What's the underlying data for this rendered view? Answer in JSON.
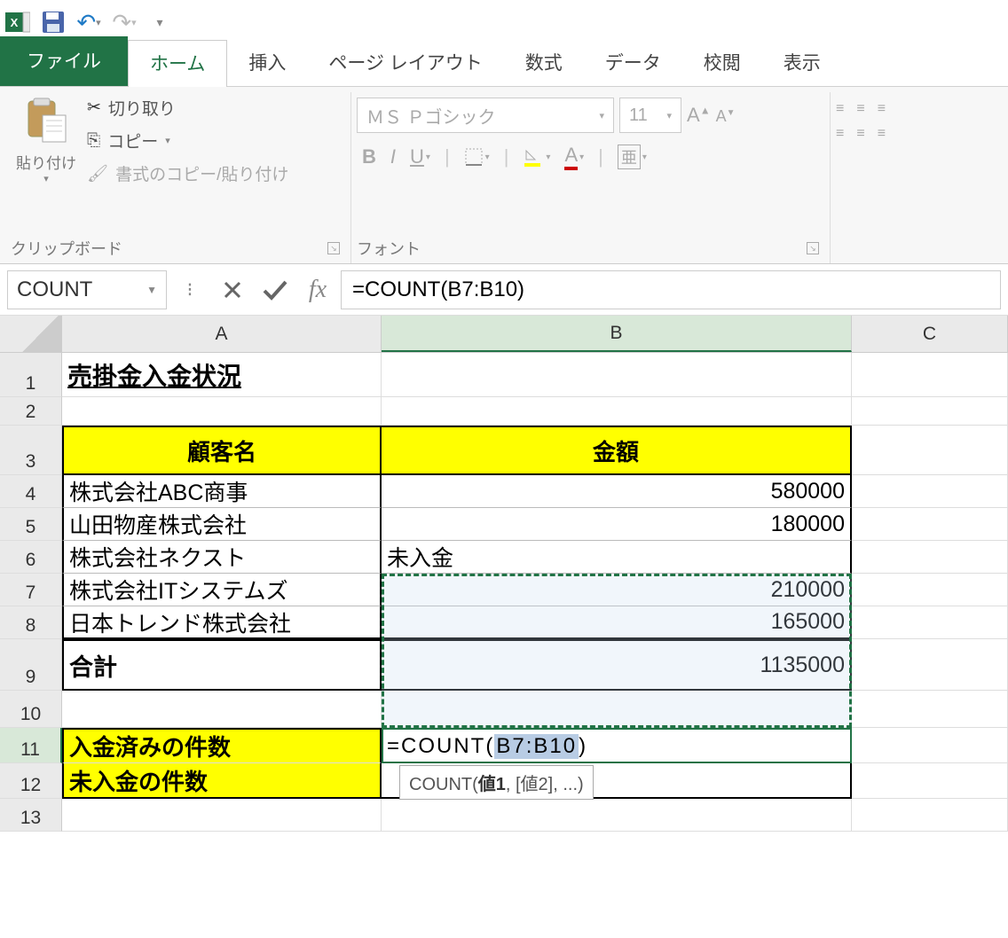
{
  "qat": {
    "save": "保存"
  },
  "ribbon": {
    "tabs": {
      "file": "ファイル",
      "home": "ホーム",
      "insert": "挿入",
      "layout": "ページ レイアウト",
      "formulas": "数式",
      "data": "データ",
      "review": "校閲",
      "view": "表示"
    },
    "clipboard": {
      "paste": "貼り付け",
      "cut": "切り取り",
      "copy": "コピー",
      "format_painter": "書式のコピー/貼り付け",
      "label": "クリップボード"
    },
    "font": {
      "font_name": "ＭＳ Ｐゴシック",
      "font_size": "11",
      "label": "フォント",
      "ruby": "亜"
    }
  },
  "formula_bar": {
    "name_box": "COUNT",
    "formula": "=COUNT(B7:B10)"
  },
  "cols": {
    "A": "A",
    "B": "B",
    "C": "C"
  },
  "sheet": {
    "title": "売掛金入金状況",
    "header_a": "顧客名",
    "header_b": "金額",
    "rows": [
      {
        "name": "株式会社ABC商事",
        "value": "580000"
      },
      {
        "name": "山田物産株式会社",
        "value": "180000"
      },
      {
        "name": "株式会社ネクスト",
        "value": "未入金"
      },
      {
        "name": "株式会社ITシステムズ",
        "value": "210000"
      },
      {
        "name": "日本トレンド株式会社",
        "value": "165000"
      }
    ],
    "sum_label": "合計",
    "sum_value": "1135000",
    "paid_label": "入金済みの件数",
    "unpaid_label": "未入金の件数",
    "editing_prefix": "=COUNT(",
    "editing_range": "B7:B10",
    "editing_suffix": ")"
  },
  "tooltip": {
    "func": "COUNT(",
    "arg1": "値1",
    "rest": ", [値2], ...)"
  }
}
